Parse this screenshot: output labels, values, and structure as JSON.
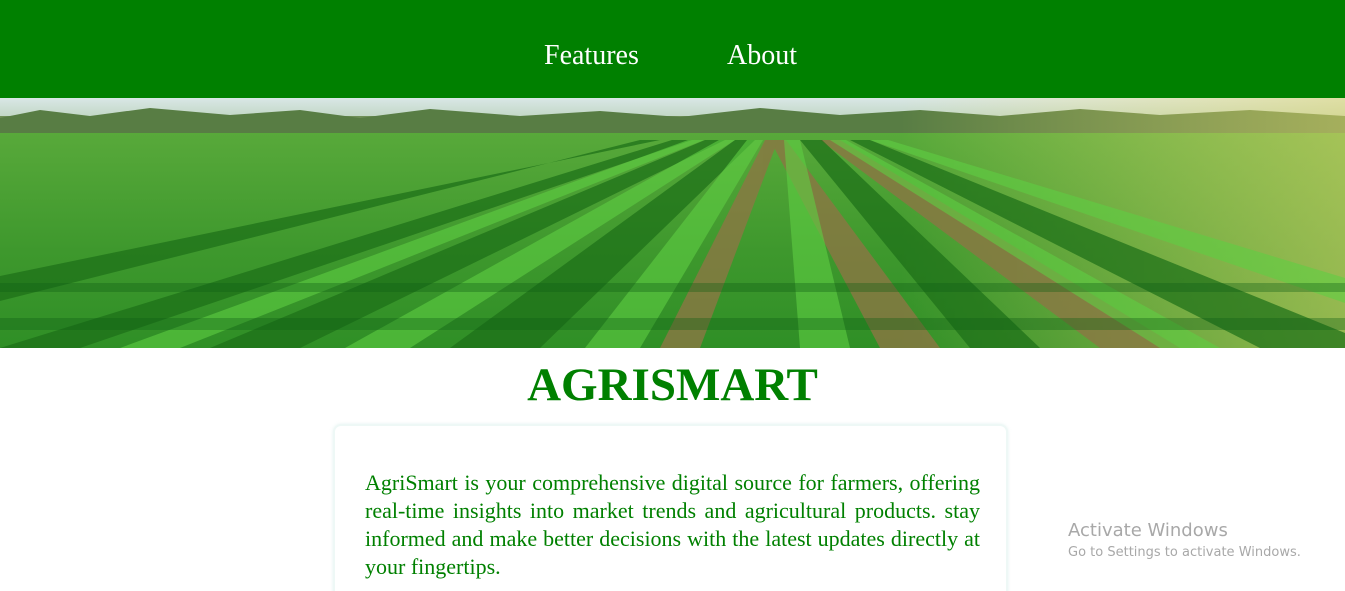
{
  "colors": {
    "brand": "#008000",
    "nav_text": "#ffffff",
    "watermark": "#a8a8a8"
  },
  "nav": {
    "items": [
      {
        "label": "Features"
      },
      {
        "label": "About"
      }
    ]
  },
  "hero": {
    "icon": "farm-field-image"
  },
  "main": {
    "title": "AGRISMART",
    "description": "AgriSmart is your comprehensive digital source for farmers, offering real-time insights into market trends and agricultural products. stay informed and make better decisions with the latest updates directly at your fingertips."
  },
  "watermark": {
    "title": "Activate Windows",
    "subtitle": "Go to Settings to activate Windows."
  }
}
